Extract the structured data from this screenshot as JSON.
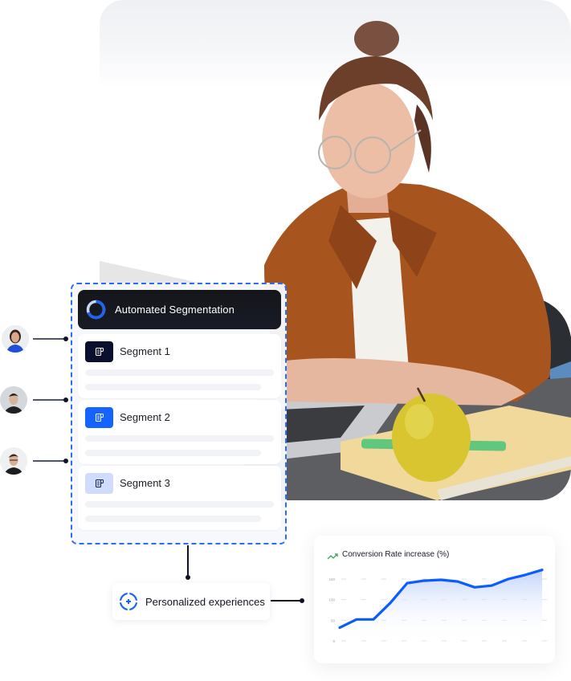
{
  "photo": {
    "subject": "woman-with-glasses-at-laptop",
    "colors": {
      "shirt": "#a8541f",
      "skin": "#e8b8a0",
      "hair": "#6b3f2a",
      "apple": "#d9c732",
      "notebook": "#f0d99a",
      "marker": "#5fc77e",
      "desk": "#5a5a5c"
    }
  },
  "segmentation": {
    "title": "Automated Segmentation",
    "accent": "#1f63f5",
    "segments": [
      {
        "label": "Segment 1",
        "icon": "document-icon",
        "icon_bg": "#0b0f2e",
        "icon_fg": "#ffffff"
      },
      {
        "label": "Segment 2",
        "icon": "document-icon",
        "icon_bg": "#1664ff",
        "icon_fg": "#ffffff"
      },
      {
        "label": "Segment 3",
        "icon": "document-icon",
        "icon_bg": "#cfdcfb",
        "icon_fg": "#13204a"
      }
    ]
  },
  "avatars": [
    {
      "name": "avatar-woman",
      "shirt": "#1e4fd8",
      "hair": "#3a2418",
      "skin": "#d9a88a"
    },
    {
      "name": "avatar-man-1",
      "shirt": "#1f2024",
      "hair": "#25201d",
      "skin": "#d8b39c"
    },
    {
      "name": "avatar-man-2",
      "shirt": "#1c1c1e",
      "hair": "#3a2a1e",
      "skin": "#dcb096"
    }
  ],
  "personalized": {
    "label": "Personalized experiences",
    "icon": "crosshair-icon"
  },
  "chart_data": {
    "type": "area",
    "title": "Conversion Rate increase (%)",
    "xlabel": "",
    "ylabel": "",
    "x": [
      1,
      2,
      3,
      4,
      5,
      6,
      7,
      8,
      9,
      10,
      11,
      12,
      13
    ],
    "series": [
      {
        "name": "Conversion Rate increase",
        "values": [
          32,
          52,
          52,
          92,
          140,
          146,
          148,
          144,
          130,
          134,
          150,
          160,
          172
        ],
        "color": "#0b5cff"
      }
    ],
    "ylim": [
      0,
      175
    ],
    "yticks": [
      0,
      50,
      100,
      150
    ],
    "ytick_labels": [
      "0",
      "50",
      "100",
      "150"
    ],
    "grid": true,
    "legend": "none"
  }
}
